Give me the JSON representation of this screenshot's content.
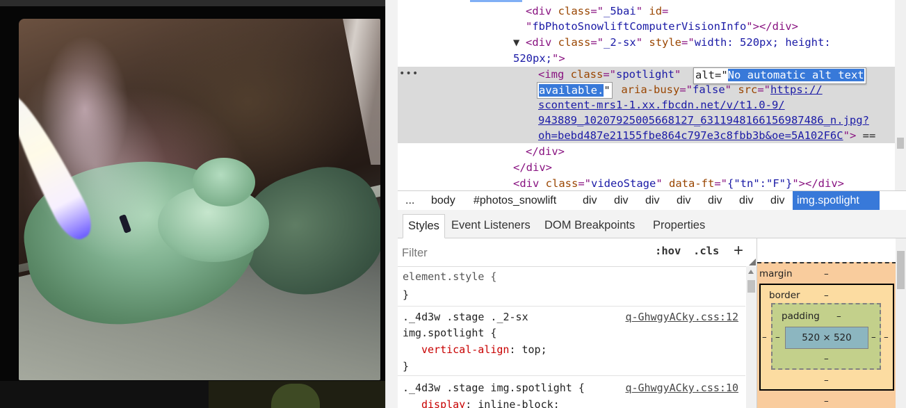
{
  "elements": {
    "lines": [
      {
        "segments": [
          {
            "t": "<div ",
            "c": "tag"
          },
          {
            "t": "class",
            "c": "an"
          },
          {
            "t": "=\"",
            "c": "tag"
          },
          {
            "t": "_5bai",
            "c": "av"
          },
          {
            "t": "\" ",
            "c": "tag"
          },
          {
            "t": "id",
            "c": "an"
          },
          {
            "t": "=",
            "c": "tag"
          }
        ]
      },
      {
        "segments": [
          {
            "t": "\"",
            "c": "tag"
          },
          {
            "t": "fbPhotoSnowliftComputerVisionInfo",
            "c": "av"
          },
          {
            "t": "\"></div>",
            "c": "tag"
          }
        ]
      },
      {
        "segments": [
          {
            "t": "<div ",
            "c": "tag"
          },
          {
            "t": "class",
            "c": "an"
          },
          {
            "t": "=\"",
            "c": "tag"
          },
          {
            "t": "_2-sx",
            "c": "av"
          },
          {
            "t": "\" ",
            "c": "tag"
          },
          {
            "t": "style",
            "c": "an"
          },
          {
            "t": "=\"",
            "c": "tag"
          },
          {
            "t": "width: 520px; height:",
            "c": "av"
          }
        ]
      },
      {
        "segments": [
          {
            "t": "520px;",
            "c": "av"
          },
          {
            "t": "\">",
            "c": "tag"
          }
        ]
      },
      {
        "segments": [
          {
            "t": "<img ",
            "c": "tag"
          },
          {
            "t": "class",
            "c": "an"
          },
          {
            "t": "=\"",
            "c": "tag"
          },
          {
            "t": "spotlight",
            "c": "av"
          },
          {
            "t": "\"",
            "c": "tag"
          }
        ]
      },
      {
        "segments": [
          {
            "t": " aria-busy",
            "c": "an"
          },
          {
            "t": "=\"",
            "c": "tag"
          },
          {
            "t": "false",
            "c": "av"
          },
          {
            "t": "\" ",
            "c": "tag"
          },
          {
            "t": "src",
            "c": "an"
          },
          {
            "t": "=\"",
            "c": "tag"
          },
          {
            "t": "https://",
            "c": "lnk"
          }
        ]
      },
      {
        "segments": [
          {
            "t": "scontent-mrs1-1.xx.fbcdn.net/v/t1.0-9/",
            "c": "lnk"
          }
        ]
      },
      {
        "segments": [
          {
            "t": "943889_10207925005668127_6311948166156987486_n.jpg?",
            "c": "lnk"
          }
        ]
      },
      {
        "segments": [
          {
            "t": "oh=bebd487e21155fbe864c797e3c8fbb3b&oe=5A102F6C",
            "c": "lnk"
          },
          {
            "t": "\">",
            "c": "tag"
          },
          {
            "t": " ==",
            "c": "plain"
          }
        ]
      },
      {
        "segments": [
          {
            "t": "</div>",
            "c": "tag"
          }
        ]
      },
      {
        "segments": [
          {
            "t": "</div>",
            "c": "tag"
          }
        ]
      },
      {
        "segments": [
          {
            "t": "<div ",
            "c": "tag"
          },
          {
            "t": "class",
            "c": "an"
          },
          {
            "t": "=\"",
            "c": "tag"
          },
          {
            "t": "videoStage",
            "c": "av"
          },
          {
            "t": "\" ",
            "c": "tag"
          },
          {
            "t": "data-ft",
            "c": "an"
          },
          {
            "t": "=\"",
            "c": "tag"
          },
          {
            "t": "{\"tn\":\"F\"}",
            "c": "av"
          },
          {
            "t": "\"></div>",
            "c": "tag"
          }
        ]
      }
    ],
    "alt_editor": {
      "attr": "alt=\"",
      "value_line1": "No automatic alt text",
      "value_line2": "available.",
      "close_quote": "\""
    },
    "toggle_glyph": "▼",
    "row_dots": "•••"
  },
  "breadcrumb": [
    "...",
    "body",
    "#photos_snowlift",
    "div",
    "div",
    "div",
    "div",
    "div",
    "div",
    "div",
    "img.spotlight"
  ],
  "tabs": [
    "Styles",
    "Event Listeners",
    "DOM Breakpoints",
    "Properties"
  ],
  "styles": {
    "filter_placeholder": "Filter",
    "hov": ":hov",
    "cls": ".cls",
    "plus": "+",
    "rules": [
      {
        "selector": "element.style {",
        "props": [],
        "close": "}",
        "source": ""
      },
      {
        "selector": "._4d3w .stage ._2-sx",
        "selector2": "img.spotlight {",
        "props": [
          {
            "name": "vertical-align",
            "value": "top;"
          }
        ],
        "close": "}",
        "source": "q-GhwgyACky.css:12"
      },
      {
        "selector": "._4d3w .stage img.spotlight {",
        "props": [
          {
            "name": "display",
            "value": "inline-block;"
          }
        ],
        "close": "",
        "source": "q-GhwgyACky.css:10"
      }
    ]
  },
  "box_model": {
    "margin_label": "margin",
    "border_label": "border",
    "padding_label": "padding",
    "dash": "–",
    "content": "520 × 520"
  },
  "icons": [
    "expand-triangle-icon",
    "plus-icon",
    "dots-icon"
  ]
}
